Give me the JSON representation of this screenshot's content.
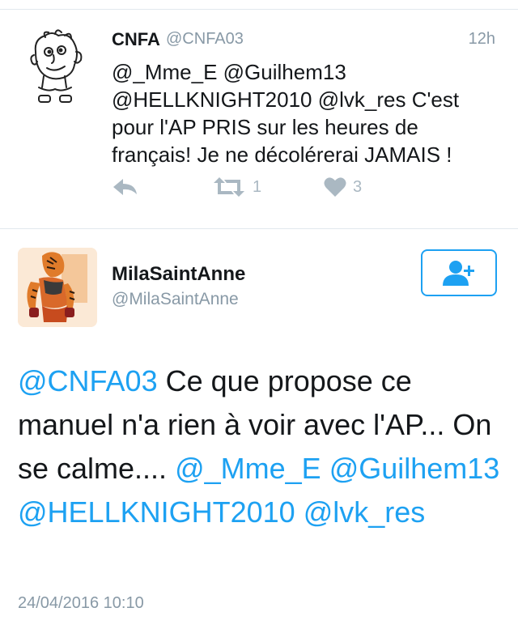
{
  "tweet1": {
    "name": "CNFA",
    "handle": "@CNFA03",
    "time": "12h",
    "text": "@_Mme_E @Guilhem13 @HELLKNIGHT2010 @lvk_res C'est pour l'AP PRIS sur les heures de français! Je ne décolérerai JAMAIS !",
    "actions": {
      "reply_icon": "reply-icon",
      "retweet_icon": "retweet-icon",
      "retweet_count": "1",
      "like_icon": "heart-icon",
      "like_count": "3"
    }
  },
  "tweet2": {
    "name": "MilaSaintAnne",
    "handle": "@MilaSaintAnne",
    "follow_icon": "add-user-icon",
    "text_parts": {
      "m1": "@CNFA03",
      "body": " Ce que propose ce manuel n'a rien à voir avec l'AP... On se calme.... ",
      "m2": "@_Mme_E",
      "m3": "@Guilhem13",
      "m4": "@HELLKNIGHT2010",
      "m5": "@lvk_res"
    },
    "date": "24/04/2016 10:10"
  },
  "colors": {
    "accent": "#1da1f2",
    "muted": "#8899a6",
    "action": "#aab8c2",
    "divider": "#e1e8ed"
  }
}
